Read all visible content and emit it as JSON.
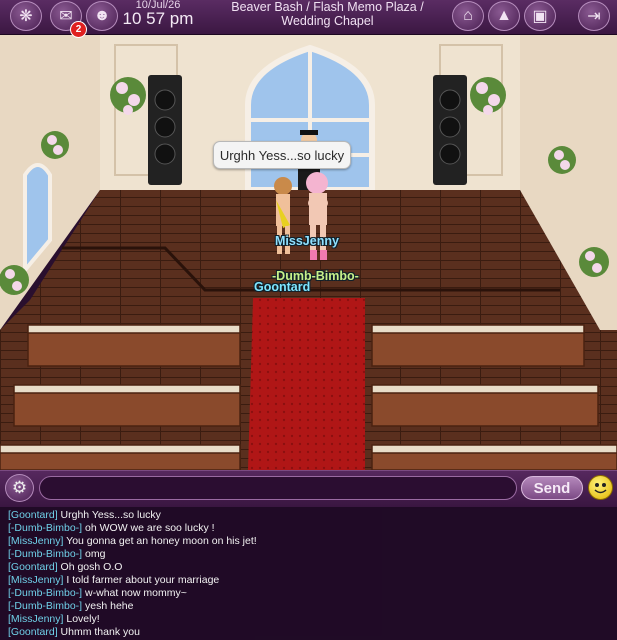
{
  "header": {
    "date": "10/Jul/26",
    "time": "10 57 pm",
    "location_line1": "Beaver Bash / Flash Memo Plaza /",
    "location_line2": "Wedding Chapel",
    "mail_badge": "2"
  },
  "scene": {
    "speech_bubble": "Urghh Yess...so lucky",
    "names": {
      "missjenny": "MissJenny",
      "dumbbimbo": "-Dumb-Bimbo-",
      "goontard": "Goontard"
    }
  },
  "chat": {
    "input_value": "",
    "send_label": "Send",
    "messages": [
      {
        "name": "[Goontard]",
        "text": "Urghh Yess...so lucky"
      },
      {
        "name": "[-Dumb-Bimbo-]",
        "text": "oh WOW we are soo lucky !"
      },
      {
        "name": "[MissJenny]",
        "text": "You gonna get an honey moon on his jet!"
      },
      {
        "name": "[-Dumb-Bimbo-]",
        "text": "omg"
      },
      {
        "name": "[Goontard]",
        "text": "Oh gosh O.O"
      },
      {
        "name": "[MissJenny]",
        "text": "I told farmer about your marriage"
      },
      {
        "name": "[-Dumb-Bimbo-]",
        "text": "w-what now mommy~"
      },
      {
        "name": "[-Dumb-Bimbo-]",
        "text": "yesh hehe"
      },
      {
        "name": "[MissJenny]",
        "text": "Lovely!"
      },
      {
        "name": "[Goontard]",
        "text": "Uhmm thank you"
      }
    ]
  },
  "icons": {
    "left": [
      "compass-icon",
      "mail-icon",
      "friends-icon"
    ],
    "right": [
      "home-icon",
      "shirt-icon",
      "bag-icon",
      "exit-icon"
    ],
    "chat": [
      "gear-icon",
      "smiley-icon"
    ]
  },
  "colors": {
    "ui_purple": "#4a1f52",
    "name_missjenny": "#8fe0ff",
    "name_dumbbimbo": "#c8f08a",
    "name_goontard": "#7fe6ff",
    "carpet": "#b81818"
  }
}
